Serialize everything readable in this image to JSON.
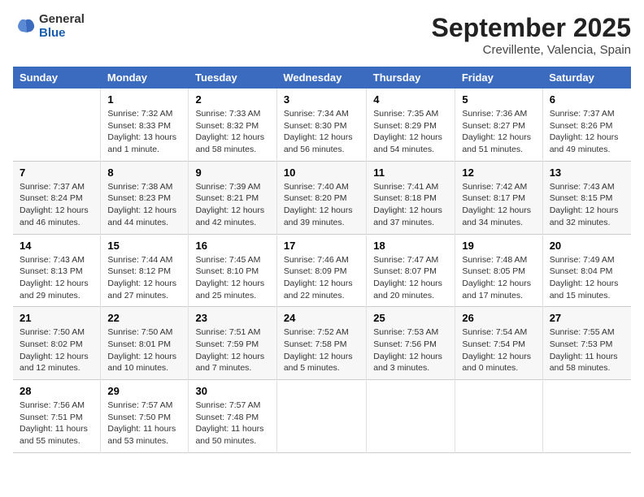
{
  "logo": {
    "general": "General",
    "blue": "Blue"
  },
  "title": "September 2025",
  "subtitle": "Crevillente, Valencia, Spain",
  "days_header": [
    "Sunday",
    "Monday",
    "Tuesday",
    "Wednesday",
    "Thursday",
    "Friday",
    "Saturday"
  ],
  "weeks": [
    [
      {
        "day": "",
        "info": ""
      },
      {
        "day": "1",
        "info": "Sunrise: 7:32 AM\nSunset: 8:33 PM\nDaylight: 13 hours\nand 1 minute."
      },
      {
        "day": "2",
        "info": "Sunrise: 7:33 AM\nSunset: 8:32 PM\nDaylight: 12 hours\nand 58 minutes."
      },
      {
        "day": "3",
        "info": "Sunrise: 7:34 AM\nSunset: 8:30 PM\nDaylight: 12 hours\nand 56 minutes."
      },
      {
        "day": "4",
        "info": "Sunrise: 7:35 AM\nSunset: 8:29 PM\nDaylight: 12 hours\nand 54 minutes."
      },
      {
        "day": "5",
        "info": "Sunrise: 7:36 AM\nSunset: 8:27 PM\nDaylight: 12 hours\nand 51 minutes."
      },
      {
        "day": "6",
        "info": "Sunrise: 7:37 AM\nSunset: 8:26 PM\nDaylight: 12 hours\nand 49 minutes."
      }
    ],
    [
      {
        "day": "7",
        "info": "Sunrise: 7:37 AM\nSunset: 8:24 PM\nDaylight: 12 hours\nand 46 minutes."
      },
      {
        "day": "8",
        "info": "Sunrise: 7:38 AM\nSunset: 8:23 PM\nDaylight: 12 hours\nand 44 minutes."
      },
      {
        "day": "9",
        "info": "Sunrise: 7:39 AM\nSunset: 8:21 PM\nDaylight: 12 hours\nand 42 minutes."
      },
      {
        "day": "10",
        "info": "Sunrise: 7:40 AM\nSunset: 8:20 PM\nDaylight: 12 hours\nand 39 minutes."
      },
      {
        "day": "11",
        "info": "Sunrise: 7:41 AM\nSunset: 8:18 PM\nDaylight: 12 hours\nand 37 minutes."
      },
      {
        "day": "12",
        "info": "Sunrise: 7:42 AM\nSunset: 8:17 PM\nDaylight: 12 hours\nand 34 minutes."
      },
      {
        "day": "13",
        "info": "Sunrise: 7:43 AM\nSunset: 8:15 PM\nDaylight: 12 hours\nand 32 minutes."
      }
    ],
    [
      {
        "day": "14",
        "info": "Sunrise: 7:43 AM\nSunset: 8:13 PM\nDaylight: 12 hours\nand 29 minutes."
      },
      {
        "day": "15",
        "info": "Sunrise: 7:44 AM\nSunset: 8:12 PM\nDaylight: 12 hours\nand 27 minutes."
      },
      {
        "day": "16",
        "info": "Sunrise: 7:45 AM\nSunset: 8:10 PM\nDaylight: 12 hours\nand 25 minutes."
      },
      {
        "day": "17",
        "info": "Sunrise: 7:46 AM\nSunset: 8:09 PM\nDaylight: 12 hours\nand 22 minutes."
      },
      {
        "day": "18",
        "info": "Sunrise: 7:47 AM\nSunset: 8:07 PM\nDaylight: 12 hours\nand 20 minutes."
      },
      {
        "day": "19",
        "info": "Sunrise: 7:48 AM\nSunset: 8:05 PM\nDaylight: 12 hours\nand 17 minutes."
      },
      {
        "day": "20",
        "info": "Sunrise: 7:49 AM\nSunset: 8:04 PM\nDaylight: 12 hours\nand 15 minutes."
      }
    ],
    [
      {
        "day": "21",
        "info": "Sunrise: 7:50 AM\nSunset: 8:02 PM\nDaylight: 12 hours\nand 12 minutes."
      },
      {
        "day": "22",
        "info": "Sunrise: 7:50 AM\nSunset: 8:01 PM\nDaylight: 12 hours\nand 10 minutes."
      },
      {
        "day": "23",
        "info": "Sunrise: 7:51 AM\nSunset: 7:59 PM\nDaylight: 12 hours\nand 7 minutes."
      },
      {
        "day": "24",
        "info": "Sunrise: 7:52 AM\nSunset: 7:58 PM\nDaylight: 12 hours\nand 5 minutes."
      },
      {
        "day": "25",
        "info": "Sunrise: 7:53 AM\nSunset: 7:56 PM\nDaylight: 12 hours\nand 3 minutes."
      },
      {
        "day": "26",
        "info": "Sunrise: 7:54 AM\nSunset: 7:54 PM\nDaylight: 12 hours\nand 0 minutes."
      },
      {
        "day": "27",
        "info": "Sunrise: 7:55 AM\nSunset: 7:53 PM\nDaylight: 11 hours\nand 58 minutes."
      }
    ],
    [
      {
        "day": "28",
        "info": "Sunrise: 7:56 AM\nSunset: 7:51 PM\nDaylight: 11 hours\nand 55 minutes."
      },
      {
        "day": "29",
        "info": "Sunrise: 7:57 AM\nSunset: 7:50 PM\nDaylight: 11 hours\nand 53 minutes."
      },
      {
        "day": "30",
        "info": "Sunrise: 7:57 AM\nSunset: 7:48 PM\nDaylight: 11 hours\nand 50 minutes."
      },
      {
        "day": "",
        "info": ""
      },
      {
        "day": "",
        "info": ""
      },
      {
        "day": "",
        "info": ""
      },
      {
        "day": "",
        "info": ""
      }
    ]
  ]
}
